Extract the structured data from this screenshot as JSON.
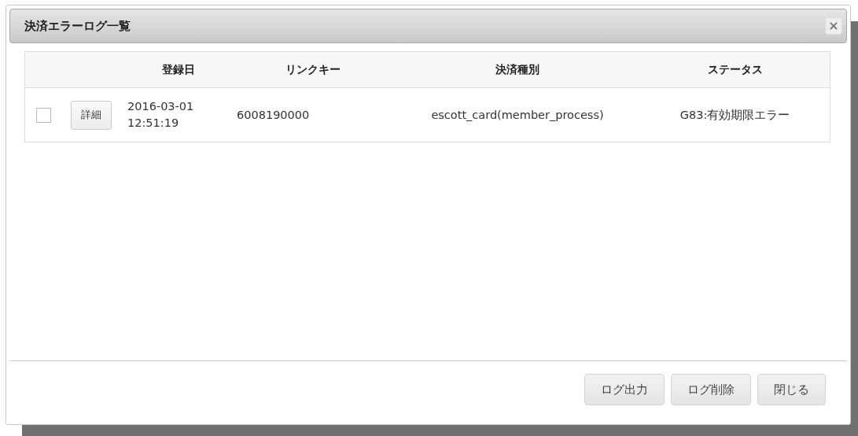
{
  "dialog": {
    "title": "決済エラーログ一覧",
    "close": "×"
  },
  "table": {
    "columns": [
      "",
      "",
      "登録日",
      "リンクキー",
      "決済種別",
      "ステータス"
    ],
    "rows": [
      {
        "checked": false,
        "detail": "詳細",
        "date": "2016-03-01",
        "time": "12:51:19",
        "link_key": "6008190000",
        "payment_type": "escott_card(member_process)",
        "status": "G83:有効期限エラー"
      }
    ]
  },
  "buttons": [
    "ログ出力",
    "ログ削除",
    "閉じる"
  ]
}
